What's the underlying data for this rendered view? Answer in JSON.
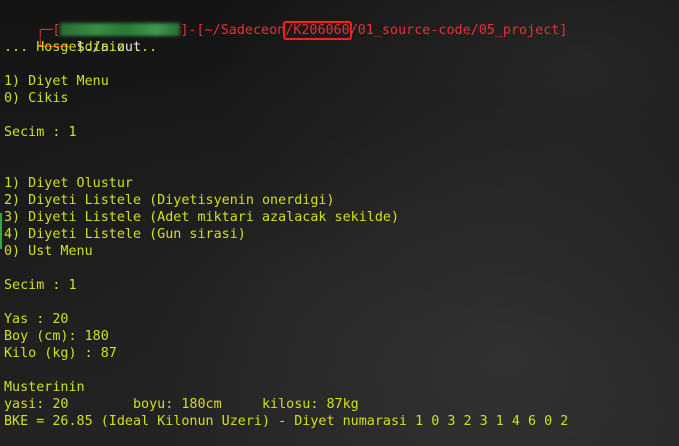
{
  "prompt": {
    "path_prefix": "]-[~/Sadeceon",
    "path_highlight": "/K206060",
    "path_suffix": "/01_source-code/05_project",
    "path_end": "]",
    "command_prefix": "$",
    "command": "./a.out"
  },
  "lines": [
    "... Hosgeldiniz ...",
    "",
    "1) Diyet Menu",
    "0) Cikis",
    "",
    "Secim : 1",
    "",
    "",
    "1) Diyet Olustur",
    "2) Diyeti Listele (Diyetisyenin onerdigi)",
    "3) Diyeti Listele (Adet miktari azalacak sekilde)",
    "4) Diyeti Listele (Gun sirasi)",
    "0) Ust Menu",
    "",
    "Secim : 1",
    "",
    "Yas : 20",
    "Boy (cm): 180",
    "Kilo (kg) : 87",
    "",
    "Musterinin",
    "yasi: 20        boyu: 180cm     kilosu: 87kg",
    "BKE = 26.85 (Ideal Kilonun Uzeri) - Diyet numarasi 1 0 3 2 3 1 4 6 0 2"
  ],
  "colors": {
    "text": "#cfe11c",
    "prompt_red": "#e8303a",
    "command_white": "#e6e6e6",
    "highlight_box": "#ff1f1f",
    "background": "#141414"
  }
}
